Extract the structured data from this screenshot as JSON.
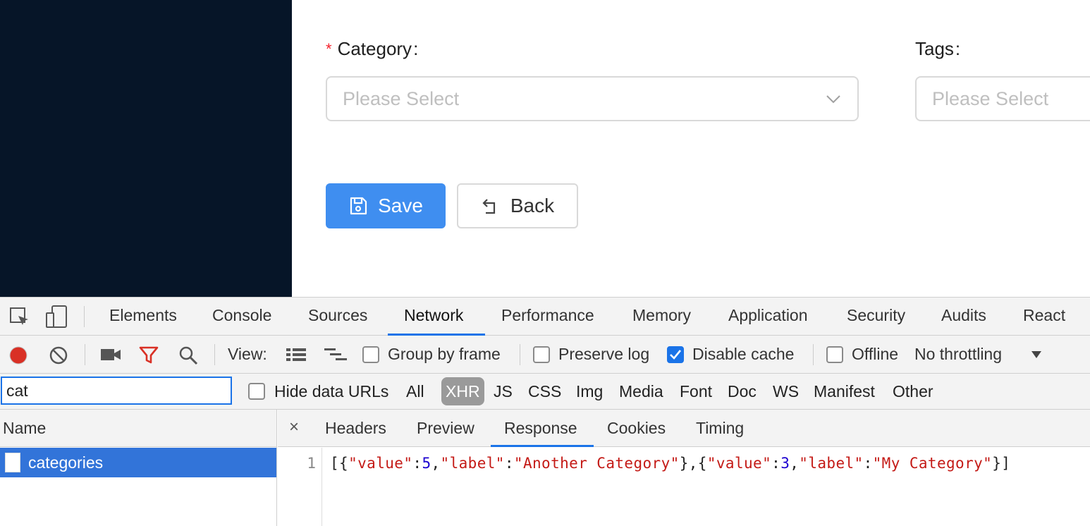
{
  "form": {
    "category": {
      "required_mark": "*",
      "label": "Category",
      "colon": ":",
      "placeholder": "Please Select"
    },
    "tags": {
      "label": "Tags",
      "colon": ":",
      "placeholder": "Please Select"
    },
    "save_button": "Save",
    "back_button": "Back"
  },
  "devtools": {
    "tabs": [
      "Elements",
      "Console",
      "Sources",
      "Network",
      "Performance",
      "Memory",
      "Application",
      "Security",
      "Audits",
      "React"
    ],
    "active_tab": "Network",
    "toolbar": {
      "view_label": "View:",
      "group_by_frame": {
        "label": "Group by frame",
        "checked": false
      },
      "preserve_log": {
        "label": "Preserve log",
        "checked": false
      },
      "disable_cache": {
        "label": "Disable cache",
        "checked": true
      },
      "offline": {
        "label": "Offline",
        "checked": false
      },
      "throttling": "No throttling"
    },
    "filter": {
      "value": "cat",
      "hide_data_urls": {
        "label": "Hide data URLs",
        "checked": false
      },
      "types": [
        "All",
        "XHR",
        "JS",
        "CSS",
        "Img",
        "Media",
        "Font",
        "Doc",
        "WS",
        "Manifest",
        "Other"
      ],
      "active_type": "XHR"
    },
    "requests": {
      "header": "Name",
      "rows": [
        {
          "name": "categories"
        }
      ]
    },
    "details": {
      "close": "×",
      "tabs": [
        "Headers",
        "Preview",
        "Response",
        "Cookies",
        "Timing"
      ],
      "active_tab": "Response",
      "line_number": "1",
      "response_tokens": [
        {
          "t": "[{",
          "c": "p"
        },
        {
          "t": "\"value\"",
          "c": "k"
        },
        {
          "t": ":",
          "c": "p"
        },
        {
          "t": "5",
          "c": "n"
        },
        {
          "t": ",",
          "c": "p"
        },
        {
          "t": "\"label\"",
          "c": "k"
        },
        {
          "t": ":",
          "c": "p"
        },
        {
          "t": "\"Another Category\"",
          "c": "s"
        },
        {
          "t": "},{",
          "c": "p"
        },
        {
          "t": "\"value\"",
          "c": "k"
        },
        {
          "t": ":",
          "c": "p"
        },
        {
          "t": "3",
          "c": "n"
        },
        {
          "t": ",",
          "c": "p"
        },
        {
          "t": "\"label\"",
          "c": "k"
        },
        {
          "t": ":",
          "c": "p"
        },
        {
          "t": "\"My Category\"",
          "c": "s"
        },
        {
          "t": "}]",
          "c": "p"
        }
      ]
    }
  }
}
